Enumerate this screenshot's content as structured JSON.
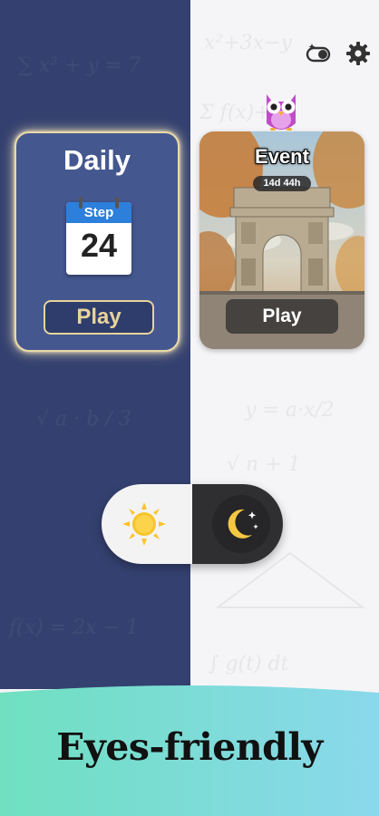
{
  "daily": {
    "title": "Daily",
    "calendar_label": "Step",
    "calendar_day": "24",
    "play_label": "Play"
  },
  "event": {
    "title": "Event",
    "timer": "14d 44h",
    "play_label": "Play"
  },
  "theme_toggle": {
    "light_icon": "sun-icon",
    "dark_icon": "moon-icon"
  },
  "top_icons": [
    "theme-mode-icon",
    "gear-icon"
  ],
  "banner": {
    "text": "Eyes-friendly"
  },
  "colors": {
    "left_bg": "#34406f",
    "right_bg": "#f5f5f7",
    "daily_card": "#44578f",
    "gold_accent": "#e8d49a",
    "calendar_blue": "#2d7fdc",
    "sun": "#f7c52a",
    "moon": "#f5c842",
    "dark_toggle": "#2f2f31",
    "banner_gradient": [
      "#6fe0c0",
      "#8ad8ec"
    ]
  }
}
